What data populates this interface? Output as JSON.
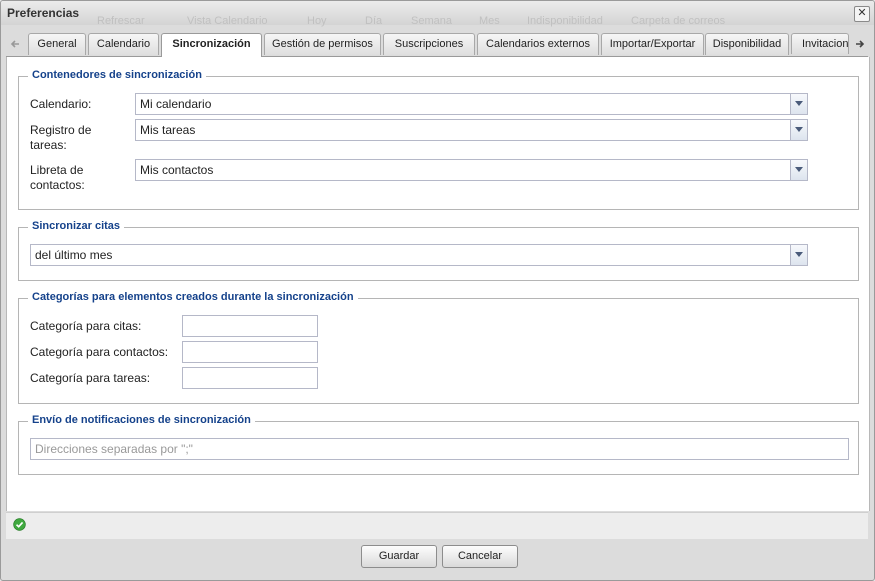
{
  "window": {
    "title": "Preferencias",
    "close_glyph": "✕"
  },
  "background_ghosts": [
    "Refrescar",
    "Vista Calendario",
    "Hoy",
    "Día",
    "Semana",
    "Mes",
    "Indisponibilidad",
    "Carpeta de correos"
  ],
  "tabs": [
    {
      "label": "General"
    },
    {
      "label": "Calendario"
    },
    {
      "label": "Sincronización",
      "active": true
    },
    {
      "label": "Gestión de permisos"
    },
    {
      "label": "Suscripciones"
    },
    {
      "label": "Calendarios externos"
    },
    {
      "label": "Importar/Exportar"
    },
    {
      "label": "Disponibilidad"
    },
    {
      "label": "Invitaciones"
    }
  ],
  "sync_containers": {
    "legend": "Contenedores de sincronización",
    "calendar_label": "Calendario:",
    "calendar_value": "Mi calendario",
    "tasks_label_1": "Registro de",
    "tasks_label_2": "tareas:",
    "tasks_value": "Mis tareas",
    "contacts_label_1": "Libreta de",
    "contacts_label_2": "contactos:",
    "contacts_value": "Mis contactos"
  },
  "sync_appointments": {
    "legend": "Sincronizar citas",
    "value": "del último mes"
  },
  "categories": {
    "legend": "Categorías para elementos creados durante la sincronización",
    "appointments_label": "Categoría para citas:",
    "contacts_label": "Categoría para contactos:",
    "tasks_label": "Categoría para tareas:"
  },
  "notifications": {
    "legend": "Envío de notificaciones de sincronización",
    "placeholder": "Direcciones separadas por \";\""
  },
  "buttons": {
    "save": "Guardar",
    "cancel": "Cancelar"
  },
  "colors": {
    "legend": "#15428b",
    "status_ok": "#3fa93f"
  },
  "icons": {
    "status": "check-circle-icon",
    "scroll_left": "arrow-left-icon",
    "scroll_right": "arrow-right-icon",
    "dropdown": "chevron-down-icon"
  }
}
